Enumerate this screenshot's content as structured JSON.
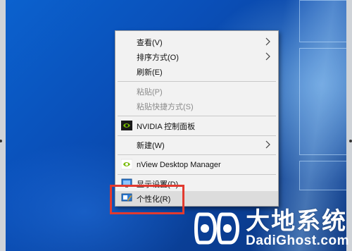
{
  "context_menu": {
    "items": [
      {
        "label": "查看(V)",
        "submenu": true,
        "disabled": false
      },
      {
        "label": "排序方式(O)",
        "submenu": true,
        "disabled": false
      },
      {
        "label": "刷新(E)",
        "submenu": false,
        "disabled": false
      },
      {
        "label": "粘贴(P)",
        "submenu": false,
        "disabled": true
      },
      {
        "label": "粘贴快捷方式(S)",
        "submenu": false,
        "disabled": true
      },
      {
        "label": "NVIDIA 控制面板",
        "submenu": false,
        "disabled": false,
        "icon": "nvidia-icon"
      },
      {
        "label": "新建(W)",
        "submenu": true,
        "disabled": false
      },
      {
        "label": "nView Desktop Manager",
        "submenu": false,
        "disabled": false,
        "icon": "nvidia-icon"
      },
      {
        "label": "显示设置(D)",
        "submenu": false,
        "disabled": false,
        "icon": "display-icon"
      },
      {
        "label": "个性化(R)",
        "submenu": false,
        "disabled": false,
        "icon": "personalize-icon",
        "highlighted": true
      }
    ]
  },
  "watermark": {
    "chinese": "大地系统",
    "english": "DadiGhost.com"
  },
  "colors": {
    "highlight_box": "#e23a2f",
    "desktop_blue": "#0a4fb8",
    "menu_bg": "#f2f2f2"
  }
}
